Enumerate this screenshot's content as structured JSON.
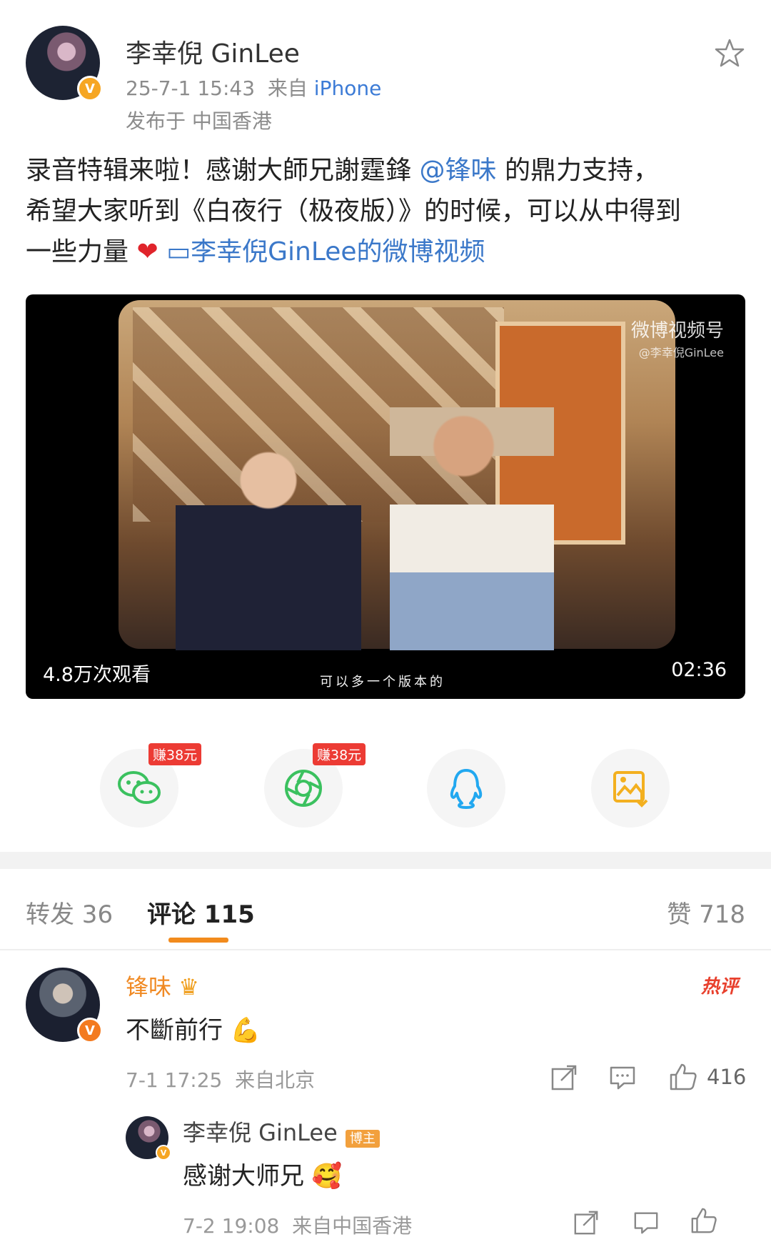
{
  "post": {
    "username": "李幸倪 GinLee",
    "time": "25-7-1 15:43",
    "source_prefix": "来自",
    "source_device": "iPhone",
    "location": "发布于 中国香港",
    "text_line1_a": "录音特辑来啦！感谢大師兄謝霆鋒",
    "text_mention": "@锋味",
    "text_line1_b": "的鼎力支持，",
    "text_line2": "希望大家听到《白夜行（极夜版）》的时候，可以从中得到",
    "text_line3_a": "一些力量",
    "text_video_link": "李幸倪GinLee的微博视频"
  },
  "video": {
    "watermark_title": "微博视频号",
    "watermark_user": "@李幸倪GinLee",
    "subtitle": "可以多一个版本的",
    "views": "4.8万次观看",
    "duration": "02:36"
  },
  "share": {
    "wechat_earn": "赚38元",
    "moments_earn": "赚38元",
    "icons": [
      "wechat-icon",
      "moments-icon",
      "qq-icon",
      "save-image-icon"
    ]
  },
  "tabs": {
    "repost": "转发 36",
    "comments": "评论 115",
    "likes": "赞 718"
  },
  "comment": {
    "author": "锋味",
    "text": "不斷前行",
    "hot_label": "热评",
    "time": "7-1 17:25",
    "location": "来自北京",
    "likes": "416"
  },
  "reply": {
    "author": "李幸倪 GinLee",
    "tag": "博主",
    "text": "感谢大师兄",
    "time": "7-2 19:08",
    "location": "来自中国香港"
  },
  "colors": {
    "accent_orange": "#f08a24",
    "link_blue": "#3b78c9",
    "earn_red": "#ec3b34"
  }
}
